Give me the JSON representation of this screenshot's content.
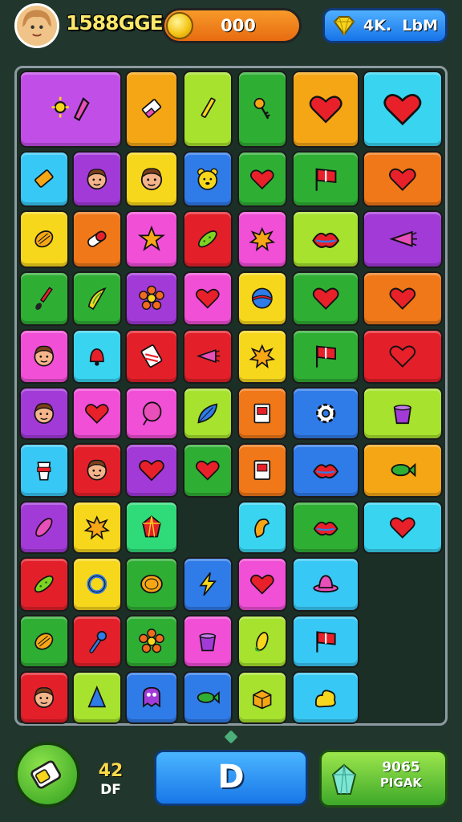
{
  "hud": {
    "player_name": "1588GGE",
    "coins": "000",
    "gems": "4K.  LbM"
  },
  "board": {
    "tiles": [
      {
        "icon": "sun-and-rocket-icon",
        "color": "#c24ee8"
      },
      {
        "icon": "eraser-icon",
        "color": "#f5a615"
      },
      {
        "icon": "pencil-icon",
        "color": "#a6e22e"
      },
      {
        "icon": "key-icon",
        "color": "#2fae34"
      },
      {
        "icon": "heart-icon",
        "color": "#f5a615"
      },
      {
        "icon": "heart-icon",
        "color": "#38d4f0"
      },
      {
        "icon": "battery-icon",
        "color": "#38c8f5"
      },
      {
        "icon": "face-icon",
        "color": "#a23ad8"
      },
      {
        "icon": "face-icon",
        "color": "#f7d71c"
      },
      {
        "icon": "bear-icon",
        "color": "#2f7be8"
      },
      {
        "icon": "heart-icon",
        "color": "#2fae34"
      },
      {
        "icon": "flag-icon",
        "color": "#2fae34"
      },
      {
        "icon": "heart-icon",
        "color": "#f07819"
      },
      {
        "icon": "melon-icon",
        "color": "#f7d71c"
      },
      {
        "icon": "pill-icon",
        "color": "#f07819"
      },
      {
        "icon": "star-icon",
        "color": "#f04fd6"
      },
      {
        "icon": "cucumber-icon",
        "color": "#e3202a"
      },
      {
        "icon": "splat-icon",
        "color": "#f04fd6"
      },
      {
        "icon": "lips-icon",
        "color": "#a6e22e"
      },
      {
        "icon": "carrot-icon",
        "color": "#a23ad8"
      },
      {
        "icon": "brush-icon",
        "color": "#2fae34"
      },
      {
        "icon": "banana-icon",
        "color": "#2fae34"
      },
      {
        "icon": "flower-icon",
        "color": "#a23ad8"
      },
      {
        "icon": "heart-icon",
        "color": "#f04fd6"
      },
      {
        "icon": "ball-icon",
        "color": "#f7d71c"
      },
      {
        "icon": "heart-icon",
        "color": "#2fae34"
      },
      {
        "icon": "heart-icon",
        "color": "#f07819"
      },
      {
        "icon": "face-icon",
        "color": "#f04fd6"
      },
      {
        "icon": "bell-icon",
        "color": "#38d4f0"
      },
      {
        "icon": "can-icon",
        "color": "#e3202a"
      },
      {
        "icon": "carrot-icon",
        "color": "#e3202a"
      },
      {
        "icon": "splat-icon",
        "color": "#f7d71c"
      },
      {
        "icon": "flag-icon",
        "color": "#2fae34"
      },
      {
        "icon": "heart-icon",
        "color": "#e3202a"
      },
      {
        "icon": "face-icon",
        "color": "#a23ad8"
      },
      {
        "icon": "heart-icon",
        "color": "#f04fd6"
      },
      {
        "icon": "balloon-icon",
        "color": "#f04fd6"
      },
      {
        "icon": "leaf-icon",
        "color": "#a6e22e"
      },
      {
        "icon": "card-icon",
        "color": "#f07819"
      },
      {
        "icon": "gear-icon",
        "color": "#2f7be8"
      },
      {
        "icon": "bucket-icon",
        "color": "#a6e22e"
      },
      {
        "icon": "cup-icon",
        "color": "#38c8f5"
      },
      {
        "icon": "face-icon",
        "color": "#e3202a"
      },
      {
        "icon": "heart-icon",
        "color": "#a23ad8"
      },
      {
        "icon": "heart-icon",
        "color": "#2fae34"
      },
      {
        "icon": "card-icon",
        "color": "#f07819"
      },
      {
        "icon": "lips-icon",
        "color": "#2f7be8"
      },
      {
        "icon": "fish-icon",
        "color": "#f5a615"
      },
      {
        "icon": "pepper-icon",
        "color": "#a23ad8"
      },
      {
        "icon": "splat-icon",
        "color": "#f7d71c"
      },
      {
        "icon": "gem-icon",
        "color": "#2fdb78"
      },
      {
        "icon": "shell-icon",
        "color": "#38d4f0"
      },
      {
        "icon": "lips-icon",
        "color": "#2fae34"
      },
      {
        "icon": "heart-icon",
        "color": "#38d4f0"
      },
      {
        "icon": "cucumber-icon",
        "color": "#e3202a"
      },
      {
        "icon": "ring-icon",
        "color": "#f7d71c"
      },
      {
        "icon": "coin-icon",
        "color": "#2fae34"
      },
      {
        "icon": "bolt-icon",
        "color": "#2f7be8"
      },
      {
        "icon": "heart-icon",
        "color": "#f04fd6"
      },
      {
        "icon": "hat-icon",
        "color": "#38c8f5"
      },
      {
        "icon": "melon-icon",
        "color": "#2fae34"
      },
      {
        "icon": "wrench-icon",
        "color": "#e3202a"
      },
      {
        "icon": "flower-icon",
        "color": "#2fae34"
      },
      {
        "icon": "bucket-icon",
        "color": "#f04fd6"
      },
      {
        "icon": "corn-icon",
        "color": "#a6e22e"
      },
      {
        "icon": "flag-icon",
        "color": "#38c8f5"
      },
      {
        "icon": "face-icon",
        "color": "#e3202a"
      },
      {
        "icon": "cone-icon",
        "color": "#a6e22e"
      },
      {
        "icon": "monster-icon",
        "color": "#2f7be8"
      },
      {
        "icon": "fish-icon",
        "color": "#2f7be8"
      },
      {
        "icon": "box-icon",
        "color": "#a6e22e"
      },
      {
        "icon": "blob-icon",
        "color": "#38c8f5"
      }
    ]
  },
  "bottom": {
    "moves_count": "42",
    "moves_unit": "DF",
    "main_button_label": "D",
    "shop_line1": "9065",
    "shop_line2": "PIGAK"
  }
}
